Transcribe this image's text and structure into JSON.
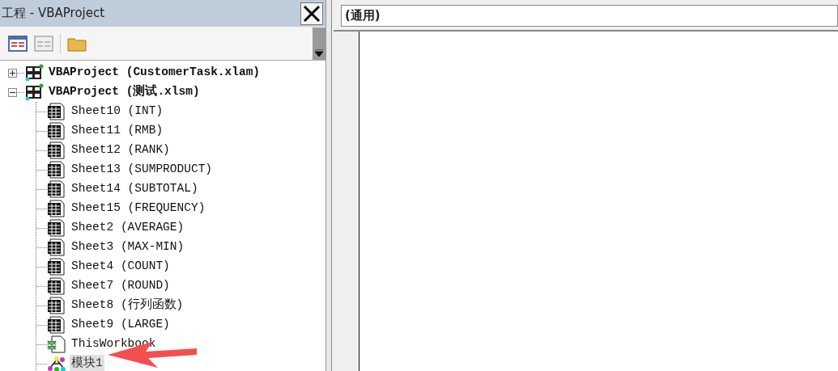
{
  "project_panel": {
    "title": "工程 - VBAProject",
    "tree": [
      {
        "kind": "project",
        "label": "VBAProject (CustomerTask.xlam)",
        "expanded": false,
        "selected": false
      },
      {
        "kind": "project",
        "label": "VBAProject (测试.xlsm)",
        "expanded": true,
        "selected": false,
        "children": [
          {
            "kind": "sheet",
            "label": "Sheet10 (INT)",
            "selected": false
          },
          {
            "kind": "sheet",
            "label": "Sheet11 (RMB)",
            "selected": false
          },
          {
            "kind": "sheet",
            "label": "Sheet12 (RANK)",
            "selected": false
          },
          {
            "kind": "sheet",
            "label": "Sheet13 (SUMPRODUCT)",
            "selected": false
          },
          {
            "kind": "sheet",
            "label": "Sheet14 (SUBTOTAL)",
            "selected": false
          },
          {
            "kind": "sheet",
            "label": "Sheet15 (FREQUENCY)",
            "selected": false
          },
          {
            "kind": "sheet",
            "label": "Sheet2 (AVERAGE)",
            "selected": false
          },
          {
            "kind": "sheet",
            "label": "Sheet3 (MAX-MIN)",
            "selected": false
          },
          {
            "kind": "sheet",
            "label": "Sheet4 (COUNT)",
            "selected": false
          },
          {
            "kind": "sheet",
            "label": "Sheet7 (ROUND)",
            "selected": false
          },
          {
            "kind": "sheet",
            "label": "Sheet8 (行列函数)",
            "selected": false
          },
          {
            "kind": "sheet",
            "label": "Sheet9 (LARGE)",
            "selected": false
          },
          {
            "kind": "workbook",
            "label": "ThisWorkbook",
            "selected": false
          },
          {
            "kind": "module",
            "label": "模块1",
            "selected": true
          }
        ]
      }
    ]
  },
  "code_window": {
    "object_dropdown": "(通用)"
  }
}
